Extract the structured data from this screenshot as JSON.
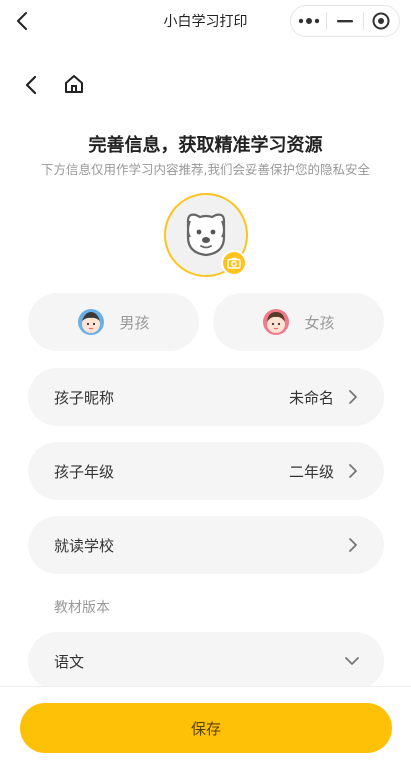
{
  "app_bar": {
    "title": "小白学习打印"
  },
  "header": {
    "headline": "完善信息，获取精准学习资源",
    "subline": "下方信息仅用作学习内容推荐,我们会妥善保护您的隐私安全"
  },
  "gender": {
    "boy_label": "男孩",
    "girl_label": "女孩"
  },
  "fields": {
    "nickname_label": "孩子昵称",
    "nickname_value": "未命名",
    "grade_label": "孩子年级",
    "grade_value": "二年级",
    "school_label": "就读学校"
  },
  "textbook": {
    "section_label": "教材版本",
    "subject_label": "语文"
  },
  "actions": {
    "save_label": "保存"
  },
  "colors": {
    "accent": "#ffc107",
    "row_bg": "#f5f5f5",
    "boy_icon": "#6ab0e8",
    "girl_icon": "#ee7a8a"
  },
  "icons": [
    "back-icon",
    "more-icon",
    "minimize-icon",
    "close-target-icon",
    "home-icon",
    "dog-avatar-icon",
    "camera-icon",
    "boy-face-icon",
    "girl-face-icon",
    "chevron-right-icon",
    "chevron-down-icon"
  ]
}
